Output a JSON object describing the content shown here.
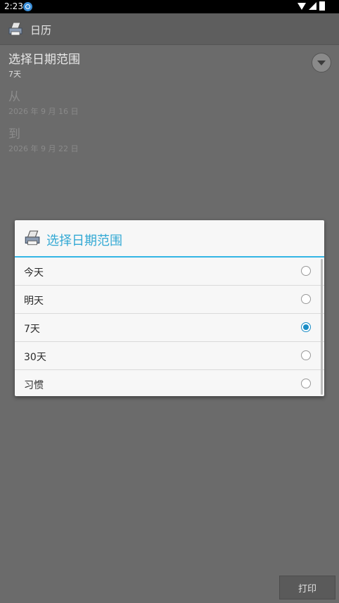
{
  "status_bar": {
    "time": "2:23"
  },
  "app_bar": {
    "title": "日历"
  },
  "settings": {
    "range": {
      "title": "选择日期范围",
      "value": "7天"
    },
    "from": {
      "title": "从",
      "value": "2026 年 9 月 16 日"
    },
    "to": {
      "title": "到",
      "value": "2026 年 9 月 22 日"
    }
  },
  "dialog": {
    "title": "选择日期范围",
    "options": [
      {
        "label": "今天",
        "selected": false
      },
      {
        "label": "明天",
        "selected": false
      },
      {
        "label": "7天",
        "selected": true
      },
      {
        "label": "30天",
        "selected": false
      },
      {
        "label": "习惯",
        "selected": false
      }
    ],
    "accent_color": "#33b5e5"
  },
  "footer": {
    "print_label": "打印"
  }
}
